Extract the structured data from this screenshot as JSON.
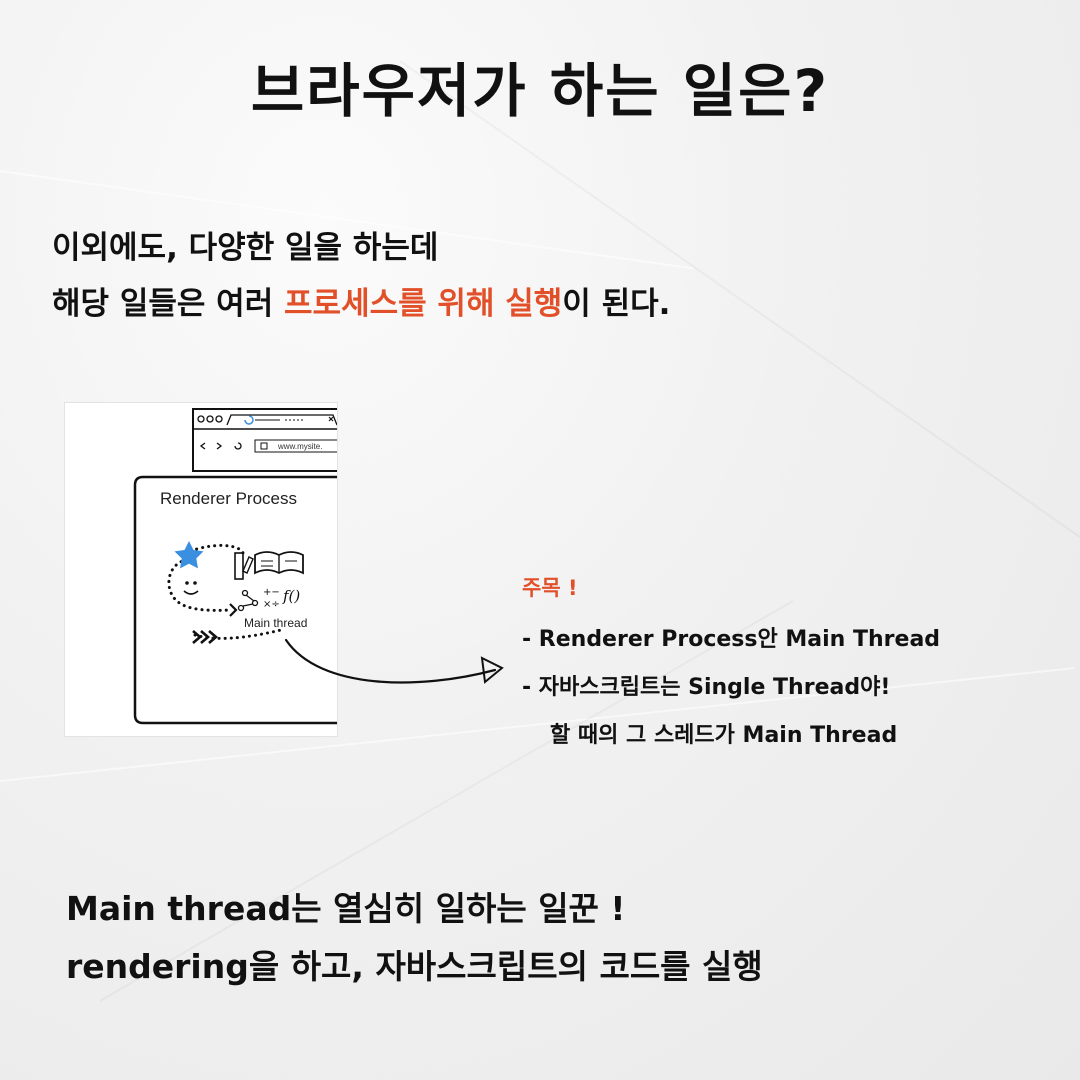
{
  "title": "브라우저가 하는 일은?",
  "intro": {
    "line1": "이외에도, 다양한 일을 하는데",
    "line2_before": "해당 일들은 여러 ",
    "line2_highlight": "프로세스를 위해 실행",
    "line2_after": "이 된다."
  },
  "figure": {
    "renderer_label": "Renderer Process",
    "main_thread_label": "Main thread",
    "url_text": "www.mysite."
  },
  "note": {
    "title": "주목 !",
    "line1": "- Renderer Process안 Main Thread",
    "line2": "- 자바스크립트는 Single Thread야!",
    "line3": "할 때의 그 스레드가 Main Thread"
  },
  "outro": {
    "line1": "Main thread는 열심히 일하는 일꾼 !",
    "line2": "rendering을 하고, 자바스크립트의 코드를 실행"
  },
  "colors": {
    "accent": "#e2502a",
    "star": "#3b8fe0"
  }
}
